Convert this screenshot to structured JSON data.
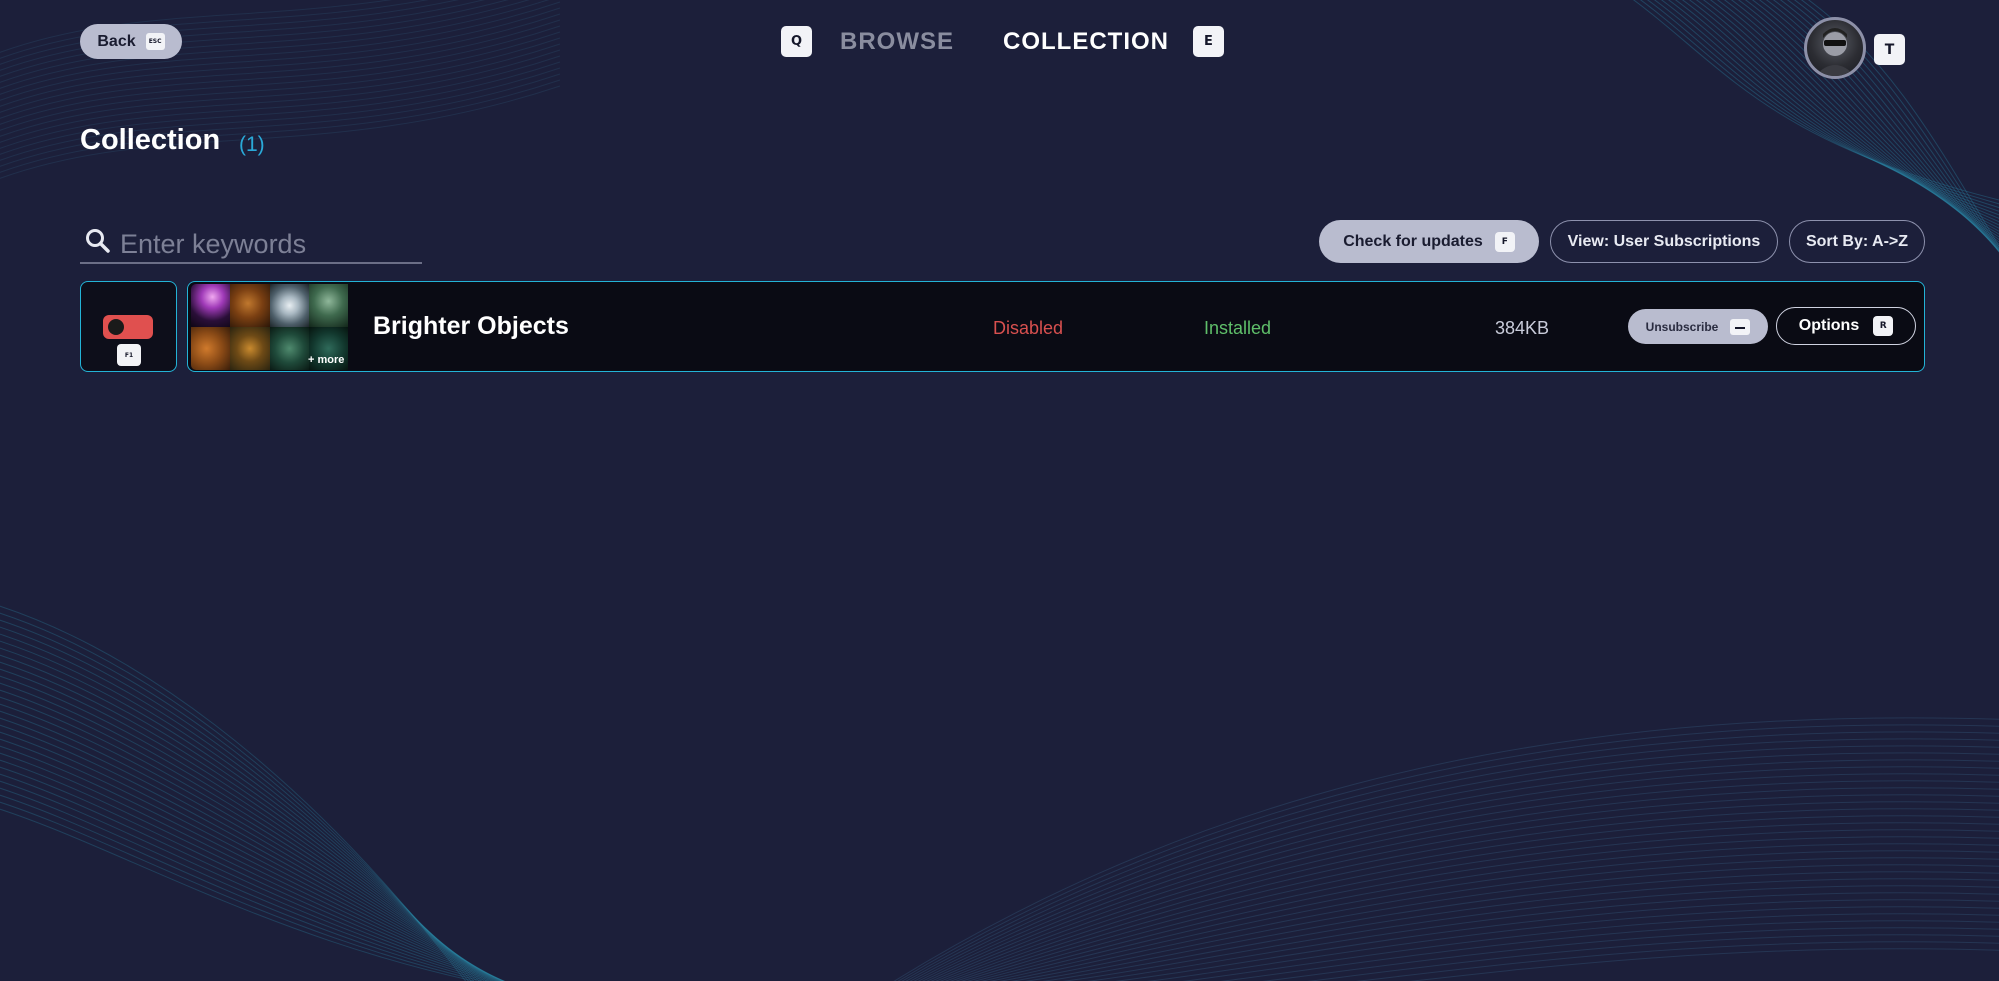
{
  "topbar": {
    "back_label": "Back",
    "back_key": "ESC",
    "tabs": [
      {
        "key": "Q",
        "label": "BROWSE",
        "active": false
      },
      {
        "label": "COLLECTION",
        "key": "E",
        "active": true
      }
    ],
    "profile_key": "T"
  },
  "heading": {
    "title": "Collection",
    "count": "(1)"
  },
  "search": {
    "placeholder": "Enter keywords",
    "value": ""
  },
  "toolbar": {
    "check_updates_label": "Check for updates",
    "check_updates_key": "F",
    "view_label": "View: User Subscriptions",
    "sort_label": "Sort By: A->Z"
  },
  "items": [
    {
      "toggle_key": "F1",
      "name": "Brighter Objects",
      "more_label": "+ more",
      "state": "Disabled",
      "install_status": "Installed",
      "size": "384KB",
      "unsubscribe_label": "Unsubscribe",
      "options_label": "Options",
      "options_key": "R"
    }
  ],
  "colors": {
    "background": "#1c1f3a",
    "accent": "#23b3d6",
    "count": "#2aa9d8",
    "disabled": "#d8504f",
    "installed": "#5fbf6a",
    "toggle_off": "#e0504f",
    "pill_fill": "#b9bccf"
  }
}
